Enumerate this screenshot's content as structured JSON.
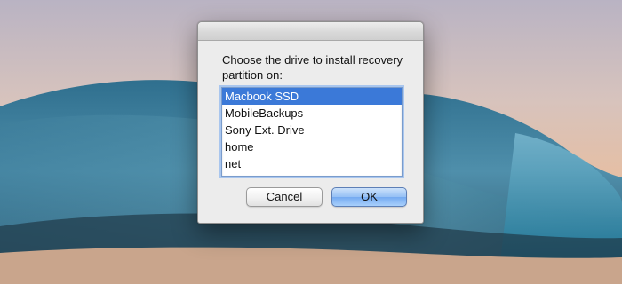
{
  "dialog": {
    "prompt": "Choose the drive to install recovery partition on:",
    "drives": [
      "Macbook SSD",
      "MobileBackups",
      "Sony Ext. Drive",
      "home",
      "net"
    ],
    "selected_index": 0,
    "cancel_label": "Cancel",
    "ok_label": "OK"
  },
  "colors": {
    "selection": "#3b79d8",
    "default_button": "#74aaf1",
    "dialog_background": "#ececec"
  }
}
